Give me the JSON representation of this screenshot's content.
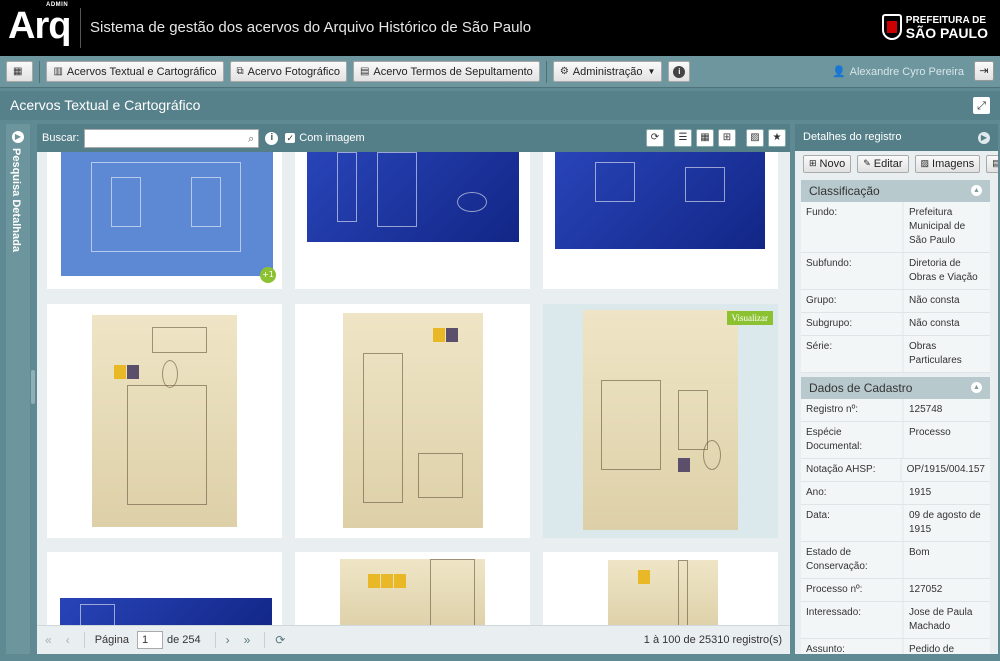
{
  "header": {
    "logo_text": "Arq",
    "logo_badge": "ADMIN",
    "system_title": "Sistema de gestão dos acervos do Arquivo Histórico de São Paulo",
    "prefeitura_line1": "PREFEITURA DE",
    "prefeitura_line2": "SÃO PAULO"
  },
  "nav": {
    "items": [
      {
        "label": "Acervos Textual e Cartográfico"
      },
      {
        "label": "Acervo Fotográfico"
      },
      {
        "label": "Acervo Termos de Sepultamento"
      },
      {
        "label": "Administração"
      }
    ],
    "user_name": "Alexandre Cyro Pereira"
  },
  "page": {
    "title": "Acervos Textual e Cartográfico",
    "left_panel_label": "Pesquisa Detalhada"
  },
  "search": {
    "label": "Buscar:",
    "value": "",
    "with_image_label": "Com imagem",
    "with_image_checked": true
  },
  "grid": {
    "badge_more": "+1",
    "view_button": "Visualizar"
  },
  "pager": {
    "page_label": "Página",
    "current_page": "1",
    "of_label": "de 254",
    "records": "1 à 100 de 25310 registro(s)"
  },
  "details": {
    "header": "Detalhes do registro",
    "buttons": {
      "new": "Novo",
      "edit": "Editar",
      "images": "Imagens"
    },
    "classificacao": {
      "title": "Classificação",
      "rows": [
        {
          "k": "Fundo:",
          "v": "Prefeitura Municipal de São Paulo"
        },
        {
          "k": "Subfundo:",
          "v": "Diretoria de Obras e Viação"
        },
        {
          "k": "Grupo:",
          "v": "Não consta"
        },
        {
          "k": "Subgrupo:",
          "v": "Não consta"
        },
        {
          "k": "Série:",
          "v": "Obras Particulares"
        }
      ]
    },
    "cadastro": {
      "title": "Dados de Cadastro",
      "rows": [
        {
          "k": "Registro nº:",
          "v": "125748"
        },
        {
          "k": "Espécie Documental:",
          "v": "Processo"
        },
        {
          "k": "Notação AHSP:",
          "v": "OP/1915/004.157"
        },
        {
          "k": "Ano:",
          "v": "1915"
        },
        {
          "k": "Data:",
          "v": "09 de agosto de 1915"
        },
        {
          "k": "Estado de Conservação:",
          "v": "Bom"
        },
        {
          "k": "Processo nº:",
          "v": "127052"
        },
        {
          "k": "Interessado:",
          "v": "Jose de Paula Machado"
        },
        {
          "k": "Assunto:",
          "v": "Pedido de aprovação de planta para"
        }
      ]
    }
  }
}
